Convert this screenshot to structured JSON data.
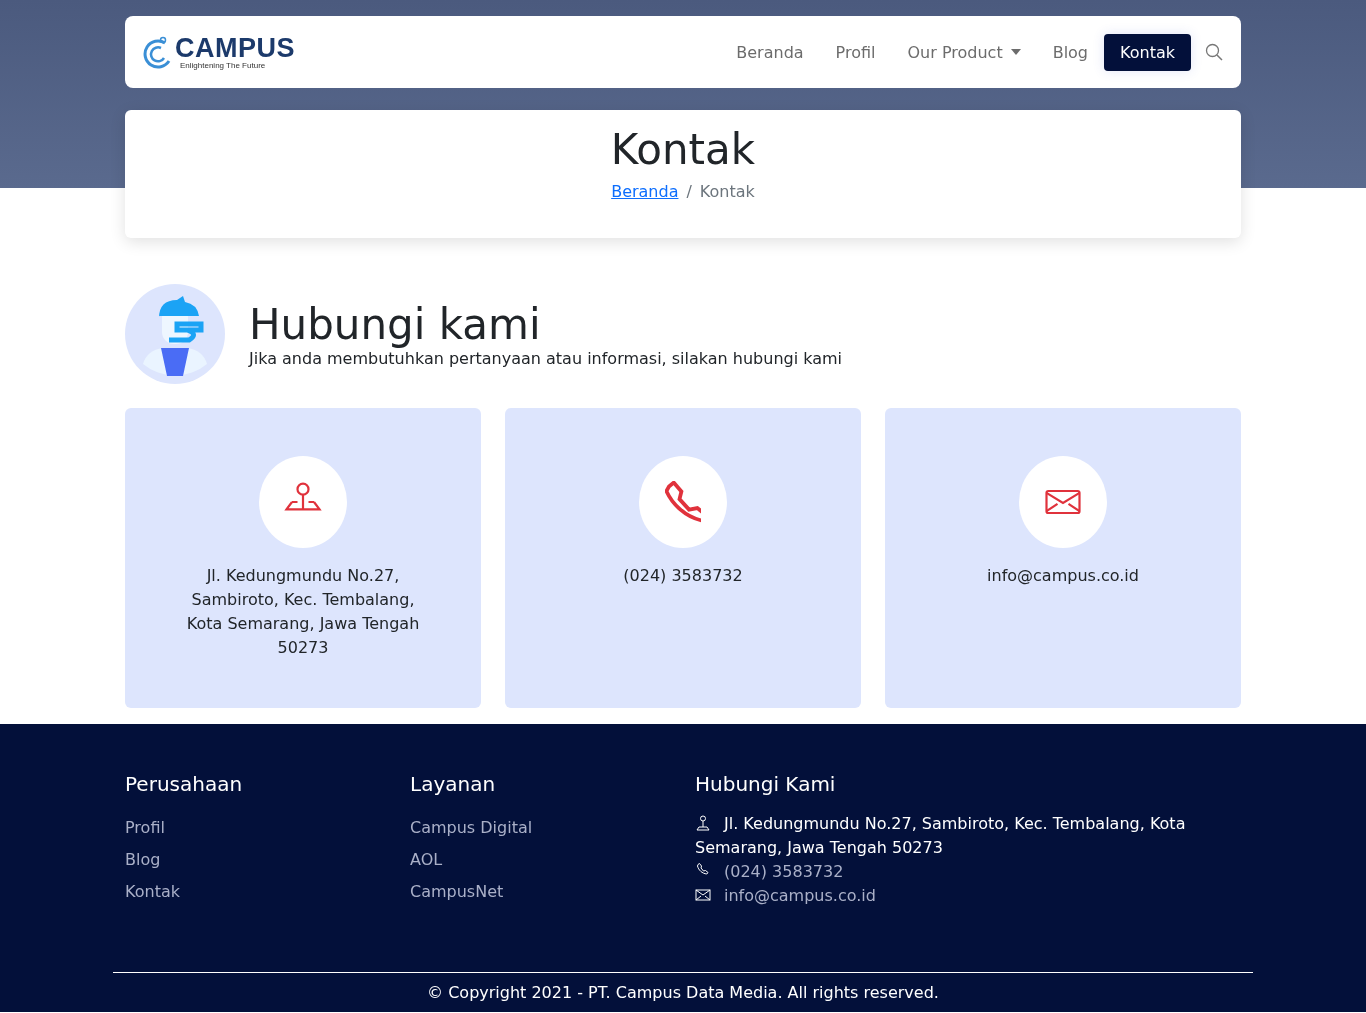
{
  "logo": {
    "name": "CAMPUS",
    "tagline": "Enlightening The Future"
  },
  "nav": [
    {
      "label": "Beranda",
      "selected": false,
      "dropdown": false
    },
    {
      "label": "Profil",
      "selected": false,
      "dropdown": false
    },
    {
      "label": "Our Product",
      "selected": false,
      "dropdown": true
    },
    {
      "label": "Blog",
      "selected": false,
      "dropdown": false
    },
    {
      "label": "Kontak",
      "selected": true,
      "dropdown": false
    }
  ],
  "page_header": {
    "title": "Kontak",
    "breadcrumb_separator": "/",
    "breadcrumb": [
      {
        "label": "Beranda",
        "link": true
      },
      {
        "label": "Kontak",
        "link": false
      }
    ]
  },
  "intro": {
    "title": "Hubungi kami",
    "subtitle": "Jika anda membutuhkan pertanyaan atau informasi, silakan hubungi kami"
  },
  "contact_cards": [
    {
      "kind": "address",
      "text": "Jl. Kedungmundu No.27, Sambiroto, Kec. Tembalang, Kota Semarang, Jawa Tengah 50273"
    },
    {
      "kind": "phone",
      "text": "(024) 3583732"
    },
    {
      "kind": "email",
      "text": "info@campus.co.id"
    }
  ],
  "footer": {
    "columns": [
      {
        "title": "Perusahaan",
        "links": [
          "Profil",
          "Blog",
          "Kontak"
        ]
      },
      {
        "title": "Layanan",
        "links": [
          "Campus Digital",
          "AOL",
          "CampusNet"
        ]
      }
    ],
    "contact": {
      "title": "Hubungi Kami",
      "items": [
        {
          "kind": "address",
          "lines": [
            "Jl. Kedungmundu No.27, Sambiroto, Kec. Tembalang, Kota",
            "Semarang, Jawa Tengah 50273"
          ]
        },
        {
          "kind": "phone",
          "text": "(024) 3583732"
        },
        {
          "kind": "email",
          "text": "info@campus.co.id"
        }
      ]
    },
    "copyright": "© Copyright 2021 - PT. Campus Data Media. All rights reserved."
  }
}
